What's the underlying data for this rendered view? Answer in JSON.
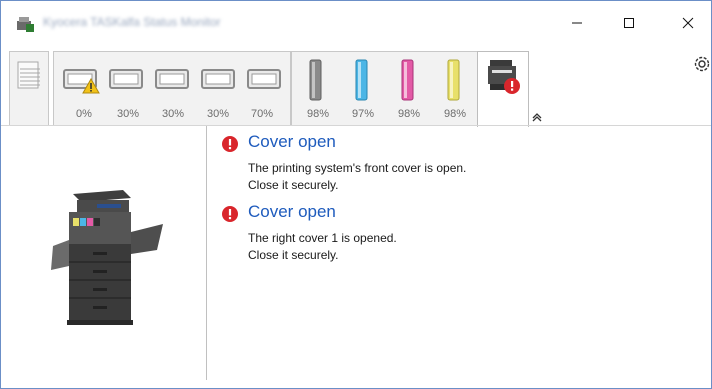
{
  "window": {
    "title": "Kyocera TASKalfa Status Monitor",
    "controls": {
      "minimize_icon": "minimize-icon",
      "maximize_icon": "maximize-icon",
      "close_icon": "close-icon"
    }
  },
  "status_strip": {
    "paper_stack_icon": "paper-stack-icon",
    "trays": [
      {
        "percent": "0%",
        "warning": true
      },
      {
        "percent": "30%",
        "warning": false
      },
      {
        "percent": "30%",
        "warning": false
      },
      {
        "percent": "30%",
        "warning": false
      },
      {
        "percent": "70%",
        "warning": false
      }
    ],
    "toners": [
      {
        "percent": "98%",
        "color": "#8a8a8a"
      },
      {
        "percent": "97%",
        "color": "#4cb6e6"
      },
      {
        "percent": "98%",
        "color": "#e35aa6"
      },
      {
        "percent": "98%",
        "color": "#e8e06a"
      }
    ],
    "device_tab": {
      "icon": "device-error-icon",
      "selected": true
    },
    "collapse_icon": "collapse-up-icon",
    "settings_icon": "gear-icon"
  },
  "colors": {
    "error_red": "#d9262c",
    "link_blue": "#1e5bbd",
    "border": "#c8c8c8"
  },
  "messages": [
    {
      "title": "Cover open",
      "lines": [
        "The printing system's front cover is open.",
        "Close it securely."
      ]
    },
    {
      "title": "Cover open",
      "lines": [
        "The right cover 1 is opened.",
        "Close it securely."
      ]
    }
  ]
}
